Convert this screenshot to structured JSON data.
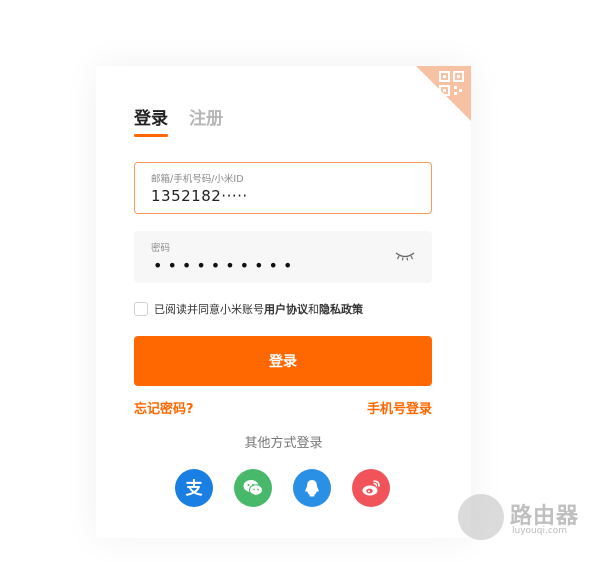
{
  "tabs": [
    {
      "label": "登录",
      "active": true
    },
    {
      "label": "注册",
      "active": false
    }
  ],
  "account": {
    "label": "邮箱/手机号码/小米ID",
    "value": "1352182·····"
  },
  "password": {
    "label": "密码",
    "value": "••••••••••",
    "toggle_icon": "eye-closed-icon"
  },
  "agreement": {
    "prefix": "已阅读并同意小米账号",
    "terms": "用户协议",
    "and": "和",
    "privacy": "隐私政策"
  },
  "login_button": "登录",
  "links": {
    "forgot": "忘记密码?",
    "phone_login": "手机号登录"
  },
  "other_methods": {
    "title": "其他方式登录",
    "icons": [
      "alipay-icon",
      "wechat-icon",
      "qq-icon",
      "weibo-icon"
    ]
  },
  "qr_icon": "qrcode-icon",
  "watermark": {
    "text": "路由器",
    "sub": "luyouqi.com"
  },
  "colors": {
    "accent": "#ff6700",
    "alipay": "#1a7fe2",
    "wechat": "#48b86b",
    "qq": "#2a90e6",
    "weibo": "#f0545a"
  }
}
